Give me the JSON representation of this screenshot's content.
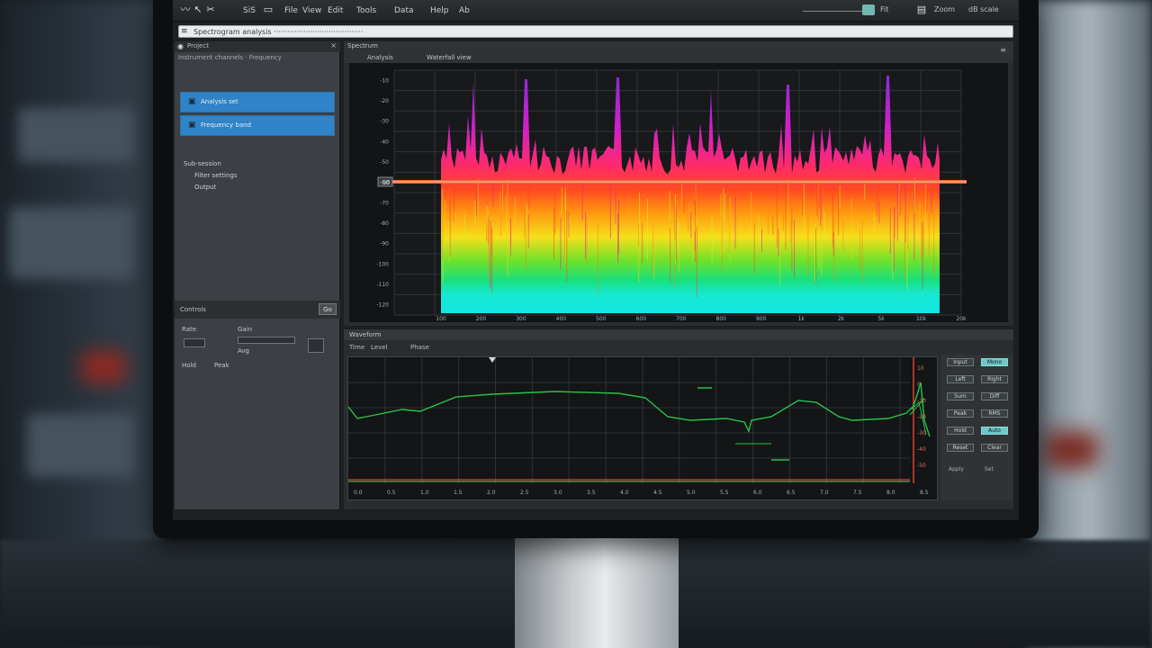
{
  "toolbar": {
    "items": [
      "SiS",
      "File",
      "View",
      "Edit",
      "Tools",
      "Data",
      "Help",
      "Ab"
    ],
    "right_items": [
      "Fit",
      "Zoom",
      "dB scale"
    ],
    "icons": [
      "wave-icon",
      "cursor-icon",
      "cut-icon",
      "folder-icon",
      "save-icon",
      "zoom-icon"
    ]
  },
  "address": {
    "icon": "menu-icon",
    "text": "Spectrogram analysis ·······································"
  },
  "left_panel": {
    "header": "Project",
    "sub_header": "Instrument channels · Frequency",
    "items": [
      {
        "icon": "channel-icon",
        "label": "Analysis set"
      },
      {
        "icon": "channel-icon",
        "label": "Frequency band"
      }
    ],
    "tree": [
      "Sub-session",
      "Filter settings",
      "Output"
    ],
    "section2_title": "Controls",
    "section2_button": "Go",
    "controls": [
      "Rate",
      "Gain",
      "Avg",
      "Hold",
      "Peak"
    ]
  },
  "spectrogram": {
    "tabs": [
      "Spectrum",
      "Analysis",
      "Waterfall view"
    ],
    "y_ticks": [
      "-10",
      "-20",
      "-30",
      "-40",
      "-50",
      "-60",
      "-70",
      "-80",
      "-90",
      "-100",
      "-110",
      "-120"
    ],
    "x_ticks": [
      "100",
      "200",
      "300",
      "400",
      "500",
      "600",
      "700",
      "800",
      "900",
      "1k",
      "2k",
      "5k",
      "10k",
      "20k"
    ],
    "marker_label": "-60"
  },
  "waveform": {
    "header": "Waveform",
    "tabs": [
      "Time",
      "Level",
      "Phase"
    ],
    "x_ticks": [
      "0.0",
      "0.5",
      "1.0",
      "1.5",
      "2.0",
      "2.5",
      "3.0",
      "3.5",
      "4.0",
      "4.5",
      "5.0",
      "5.5",
      "6.0",
      "6.5",
      "7.0",
      "7.5",
      "8.0",
      "8.5"
    ],
    "right_scale": [
      "10",
      "0",
      "-10",
      "-20",
      "-30",
      "-40",
      "-50"
    ],
    "controls": [
      {
        "label": "Input",
        "on": false
      },
      {
        "label": "Mono",
        "on": true
      },
      {
        "label": "Left",
        "on": false
      },
      {
        "label": "Right",
        "on": false
      },
      {
        "label": "Sum",
        "on": false
      },
      {
        "label": "Diff",
        "on": false
      },
      {
        "label": "Peak",
        "on": false
      },
      {
        "label": "RMS",
        "on": false
      },
      {
        "label": "Hold",
        "on": false
      },
      {
        "label": "Auto",
        "on": true
      },
      {
        "label": "Reset",
        "on": false
      },
      {
        "label": "Clear",
        "on": false
      }
    ],
    "control_footer": [
      "Apply",
      "Set"
    ]
  },
  "colors": {
    "accent_blue": "#2f83c6",
    "trace_green": "#27c24a",
    "marker_orange": "#f06a3a"
  }
}
